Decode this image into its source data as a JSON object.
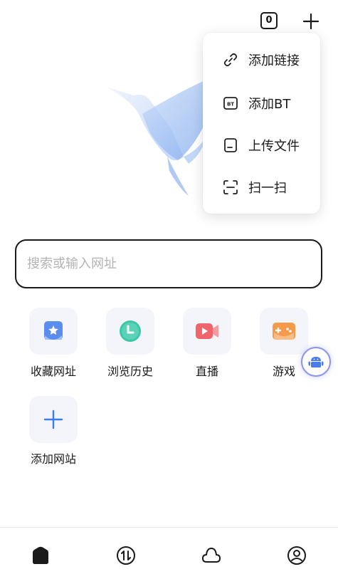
{
  "topbar": {
    "tab_count": "0"
  },
  "menu": {
    "items": [
      {
        "label": "添加链接",
        "icon": "link-icon"
      },
      {
        "label": "添加BT",
        "icon": "bt-icon"
      },
      {
        "label": "上传文件",
        "icon": "file-icon"
      },
      {
        "label": "扫一扫",
        "icon": "scan-icon"
      }
    ],
    "bt_icon_text": "BT"
  },
  "search": {
    "placeholder": "搜索或输入网址",
    "value": ""
  },
  "shortcuts": [
    {
      "label": "收藏网址",
      "icon": "star-bookmark-icon",
      "color": "#5b8dee"
    },
    {
      "label": "浏览历史",
      "icon": "clock-icon",
      "color": "#3cc7a8"
    },
    {
      "label": "直播",
      "icon": "video-camera-icon",
      "color": "#f0646d"
    },
    {
      "label": "游戏",
      "icon": "gamepad-icon",
      "color": "#f59a4a"
    },
    {
      "label": "添加网站",
      "icon": "plus-icon",
      "color": "#3b7ee8"
    }
  ],
  "bottom_nav": [
    {
      "icon": "home-icon"
    },
    {
      "icon": "transfer-icon"
    },
    {
      "icon": "cloud-icon"
    },
    {
      "icon": "profile-icon"
    }
  ]
}
